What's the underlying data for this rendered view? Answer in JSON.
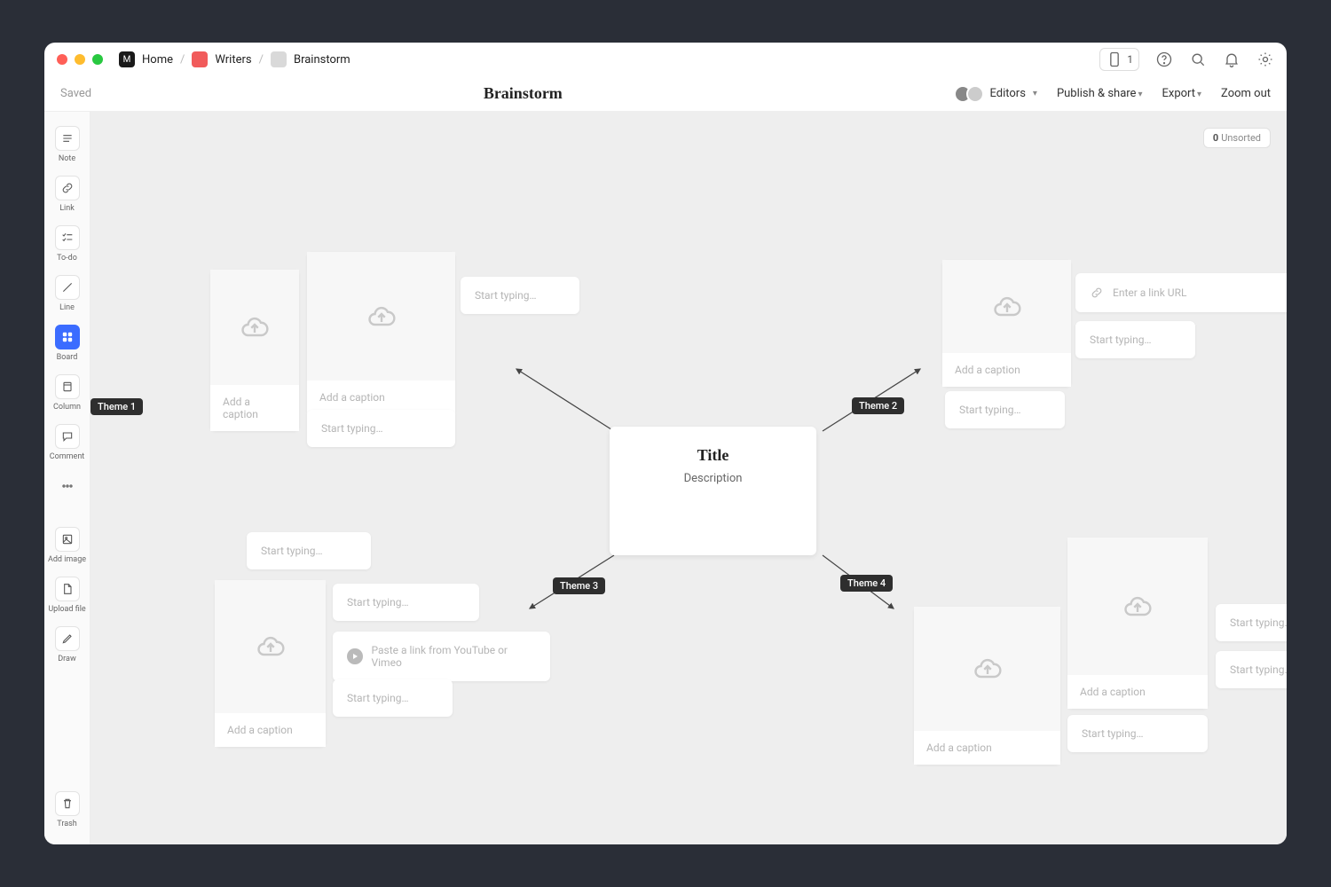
{
  "breadcrumbs": {
    "home": "Home",
    "writers": "Writers",
    "current": "Brainstorm"
  },
  "titlebar": {
    "viewer_count": "1"
  },
  "secondbar": {
    "saved": "Saved",
    "title": "Brainstorm",
    "editors": "Editors",
    "publish": "Publish & share",
    "export": "Export",
    "zoomout": "Zoom out"
  },
  "sidebar": {
    "note": "Note",
    "link": "Link",
    "todo": "To-do",
    "line": "Line",
    "board": "Board",
    "column": "Column",
    "comment": "Comment",
    "addimage": "Add image",
    "uploadfile": "Upload file",
    "draw": "Draw",
    "trash": "Trash"
  },
  "unsorted": {
    "count": "0",
    "label": "Unsorted"
  },
  "center": {
    "title": "Title",
    "desc": "Description"
  },
  "themes": {
    "t1": "Theme 1",
    "t2": "Theme 2",
    "t3": "Theme 3",
    "t4": "Theme 4"
  },
  "placeholders": {
    "caption": "Add a caption",
    "typing": "Start typing…",
    "linkurl": "Enter a link URL",
    "video": "Paste a link from YouTube or Vimeo"
  }
}
